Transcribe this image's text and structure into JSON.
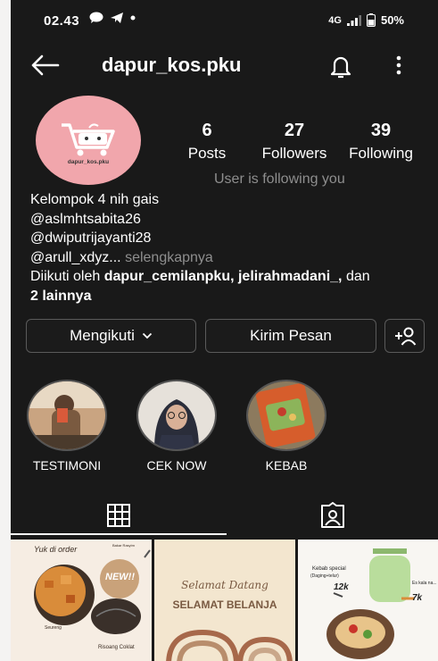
{
  "status": {
    "time": "02.43",
    "network": "4G",
    "battery": "50%"
  },
  "header": {
    "username": "dapur_kos.pku"
  },
  "profile": {
    "avatar_text": "dapur_kos.pku",
    "stats": [
      {
        "value": "6",
        "label": "Posts"
      },
      {
        "value": "27",
        "label": "Followers"
      },
      {
        "value": "39",
        "label": "Following"
      }
    ],
    "follow_note": "User is following you",
    "bio_lines": [
      "Kelompok 4 nih gais",
      "@aslmhtsabita26",
      "@dwiputrijayanti28"
    ],
    "bio_last": "@arull_xdyz...",
    "more_label": "selengkapnya",
    "followed_prefix": "Diikuti oleh",
    "followed_names": "dapur_cemilanpku, jelirahmadani_,",
    "followed_dan": "dan",
    "followed_others": "2 lainnya"
  },
  "actions": {
    "following_label": "Mengikuti",
    "message_label": "Kirim Pesan"
  },
  "highlights": [
    {
      "label": "TESTIMONI"
    },
    {
      "label": "CEK NOW"
    },
    {
      "label": "KEBAB"
    }
  ],
  "posts": [
    {
      "heading": "Yuk di order",
      "subtitle": "Bakar Rasyim",
      "badge": "NEW!!",
      "caption1": "Seureng",
      "caption2": "Risoang Coklat"
    },
    {
      "line1": "Selamat Datang",
      "line2": "SELAMAT BELANJA"
    },
    {
      "heading": "Kebab special",
      "sub": "(Daging+telur)",
      "price1": "12k",
      "note": "Es kala na...",
      "price2": "7k"
    }
  ]
}
